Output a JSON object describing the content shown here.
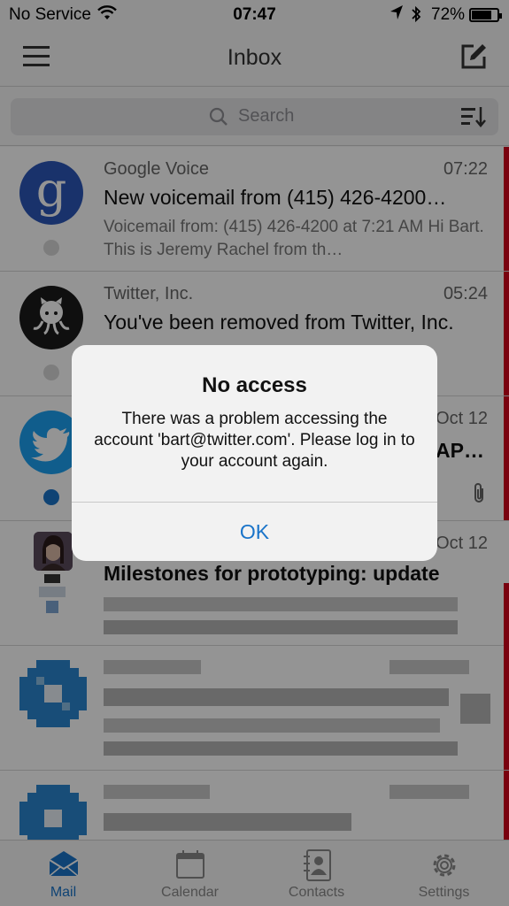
{
  "status_bar": {
    "carrier": "No Service",
    "time": "07:47",
    "battery": "72%",
    "battery_level": 0.72
  },
  "nav": {
    "title": "Inbox"
  },
  "search": {
    "placeholder": "Search"
  },
  "messages": [
    {
      "sender": "Google Voice",
      "time": "07:22",
      "subject": "New voicemail from (415) 426-4200…",
      "preview": "Voicemail from: (415) 426-4200 at 7:21 AM Hi Bart. This is Jeremy Rachel from th…",
      "avatar_letter": "g",
      "unread": false
    },
    {
      "sender": "Twitter, Inc.",
      "time": "05:24",
      "subject": "You've been removed from Twitter, Inc.",
      "preview": "",
      "unread": false
    },
    {
      "sender": "",
      "time": "Oct 12",
      "subject": "AP…",
      "preview": "",
      "unread": true,
      "has_attachment": true
    },
    {
      "sender": "",
      "time": "Oct 12",
      "subject": "Milestones for prototyping: update",
      "preview": "",
      "unread": false
    }
  ],
  "tabs": [
    {
      "label": "Mail",
      "icon": "mail-icon",
      "active": true
    },
    {
      "label": "Calendar",
      "icon": "calendar-icon",
      "active": false
    },
    {
      "label": "Contacts",
      "icon": "contacts-icon",
      "active": false
    },
    {
      "label": "Settings",
      "icon": "settings-icon",
      "active": false
    }
  ],
  "alert": {
    "title": "No access",
    "message": "There was a problem accessing the account 'bart@twitter.com'. Please log in to your account again.",
    "ok_label": "OK"
  },
  "colors": {
    "accent": "#1a74c9",
    "flag_stripe": "#d0021b",
    "twitter_blue": "#1da1f2",
    "google_blue": "#2b57b8"
  }
}
